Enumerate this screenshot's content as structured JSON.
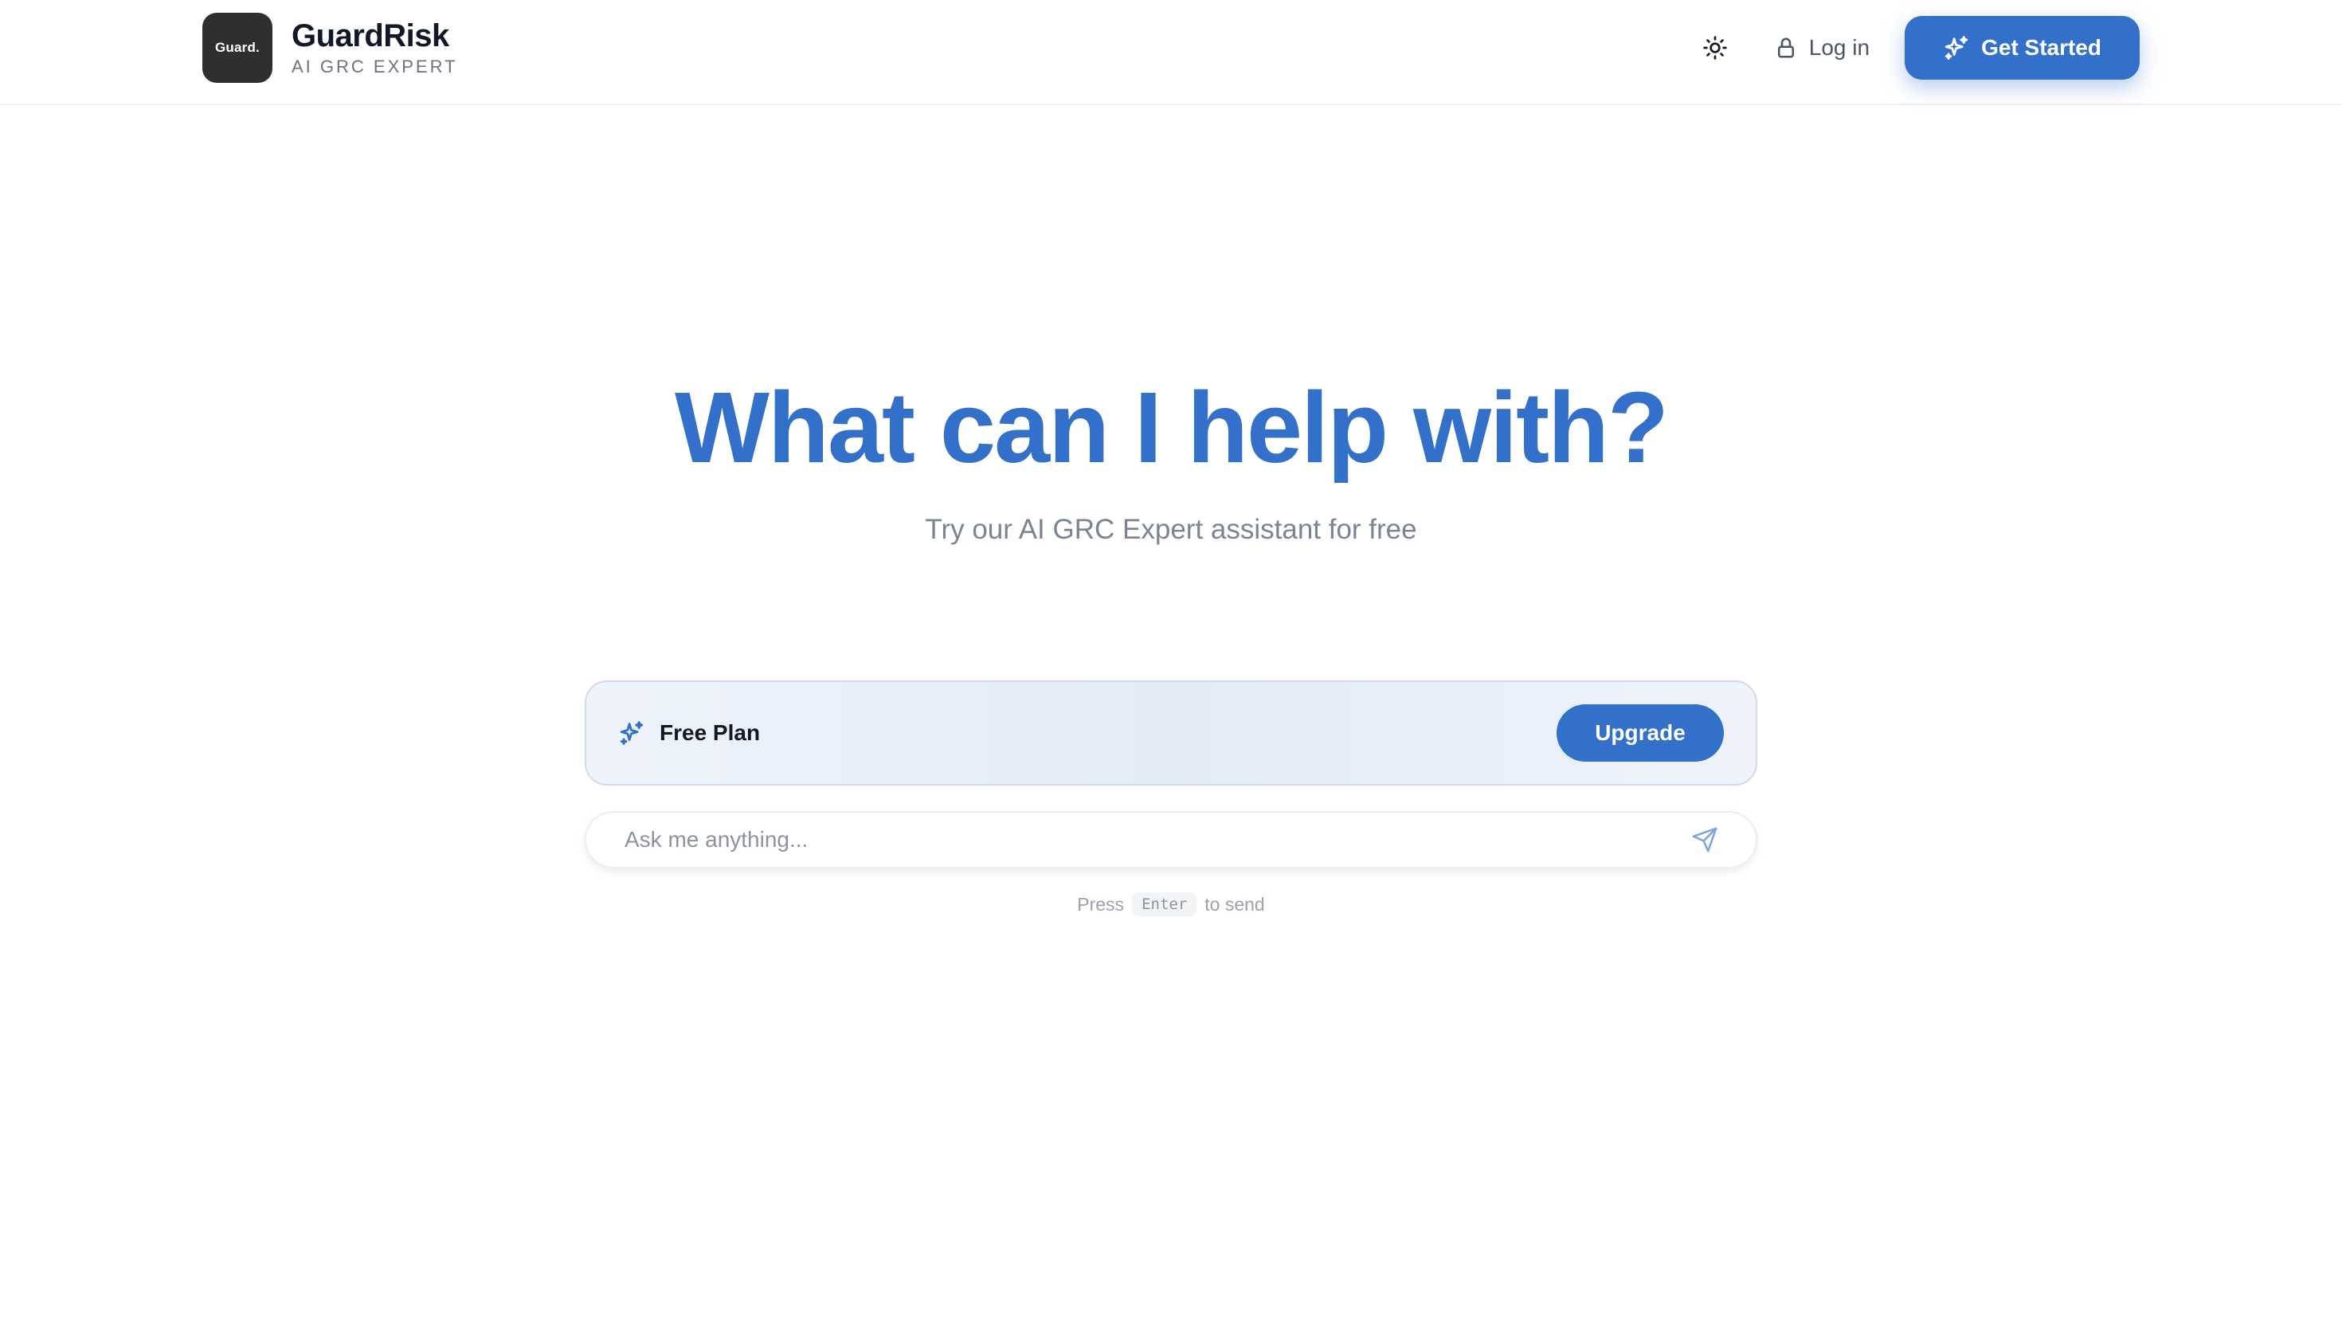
{
  "header": {
    "logo_text": "Guard.",
    "brand_name": "GuardRisk",
    "tagline": "AI GRC EXPERT",
    "theme_toggle_icon": "sun-icon",
    "login_label": "Log in",
    "login_icon": "lock-icon",
    "cta_label": "Get Started",
    "cta_icon": "sparkles-icon"
  },
  "hero": {
    "title": "What can I help with?",
    "subtitle": "Try our AI GRC Expert assistant for free"
  },
  "plan": {
    "icon": "sparkles-icon",
    "label": "Free Plan",
    "upgrade_label": "Upgrade"
  },
  "chat": {
    "placeholder": "Ask me anything...",
    "value": "",
    "send_icon": "send-icon"
  },
  "hint": {
    "prefix": "Press",
    "key": "Enter",
    "suffix": "to send"
  },
  "colors": {
    "accent": "#3370c9",
    "logo_bg": "#2f2f2f",
    "muted_text": "#7b8494"
  }
}
